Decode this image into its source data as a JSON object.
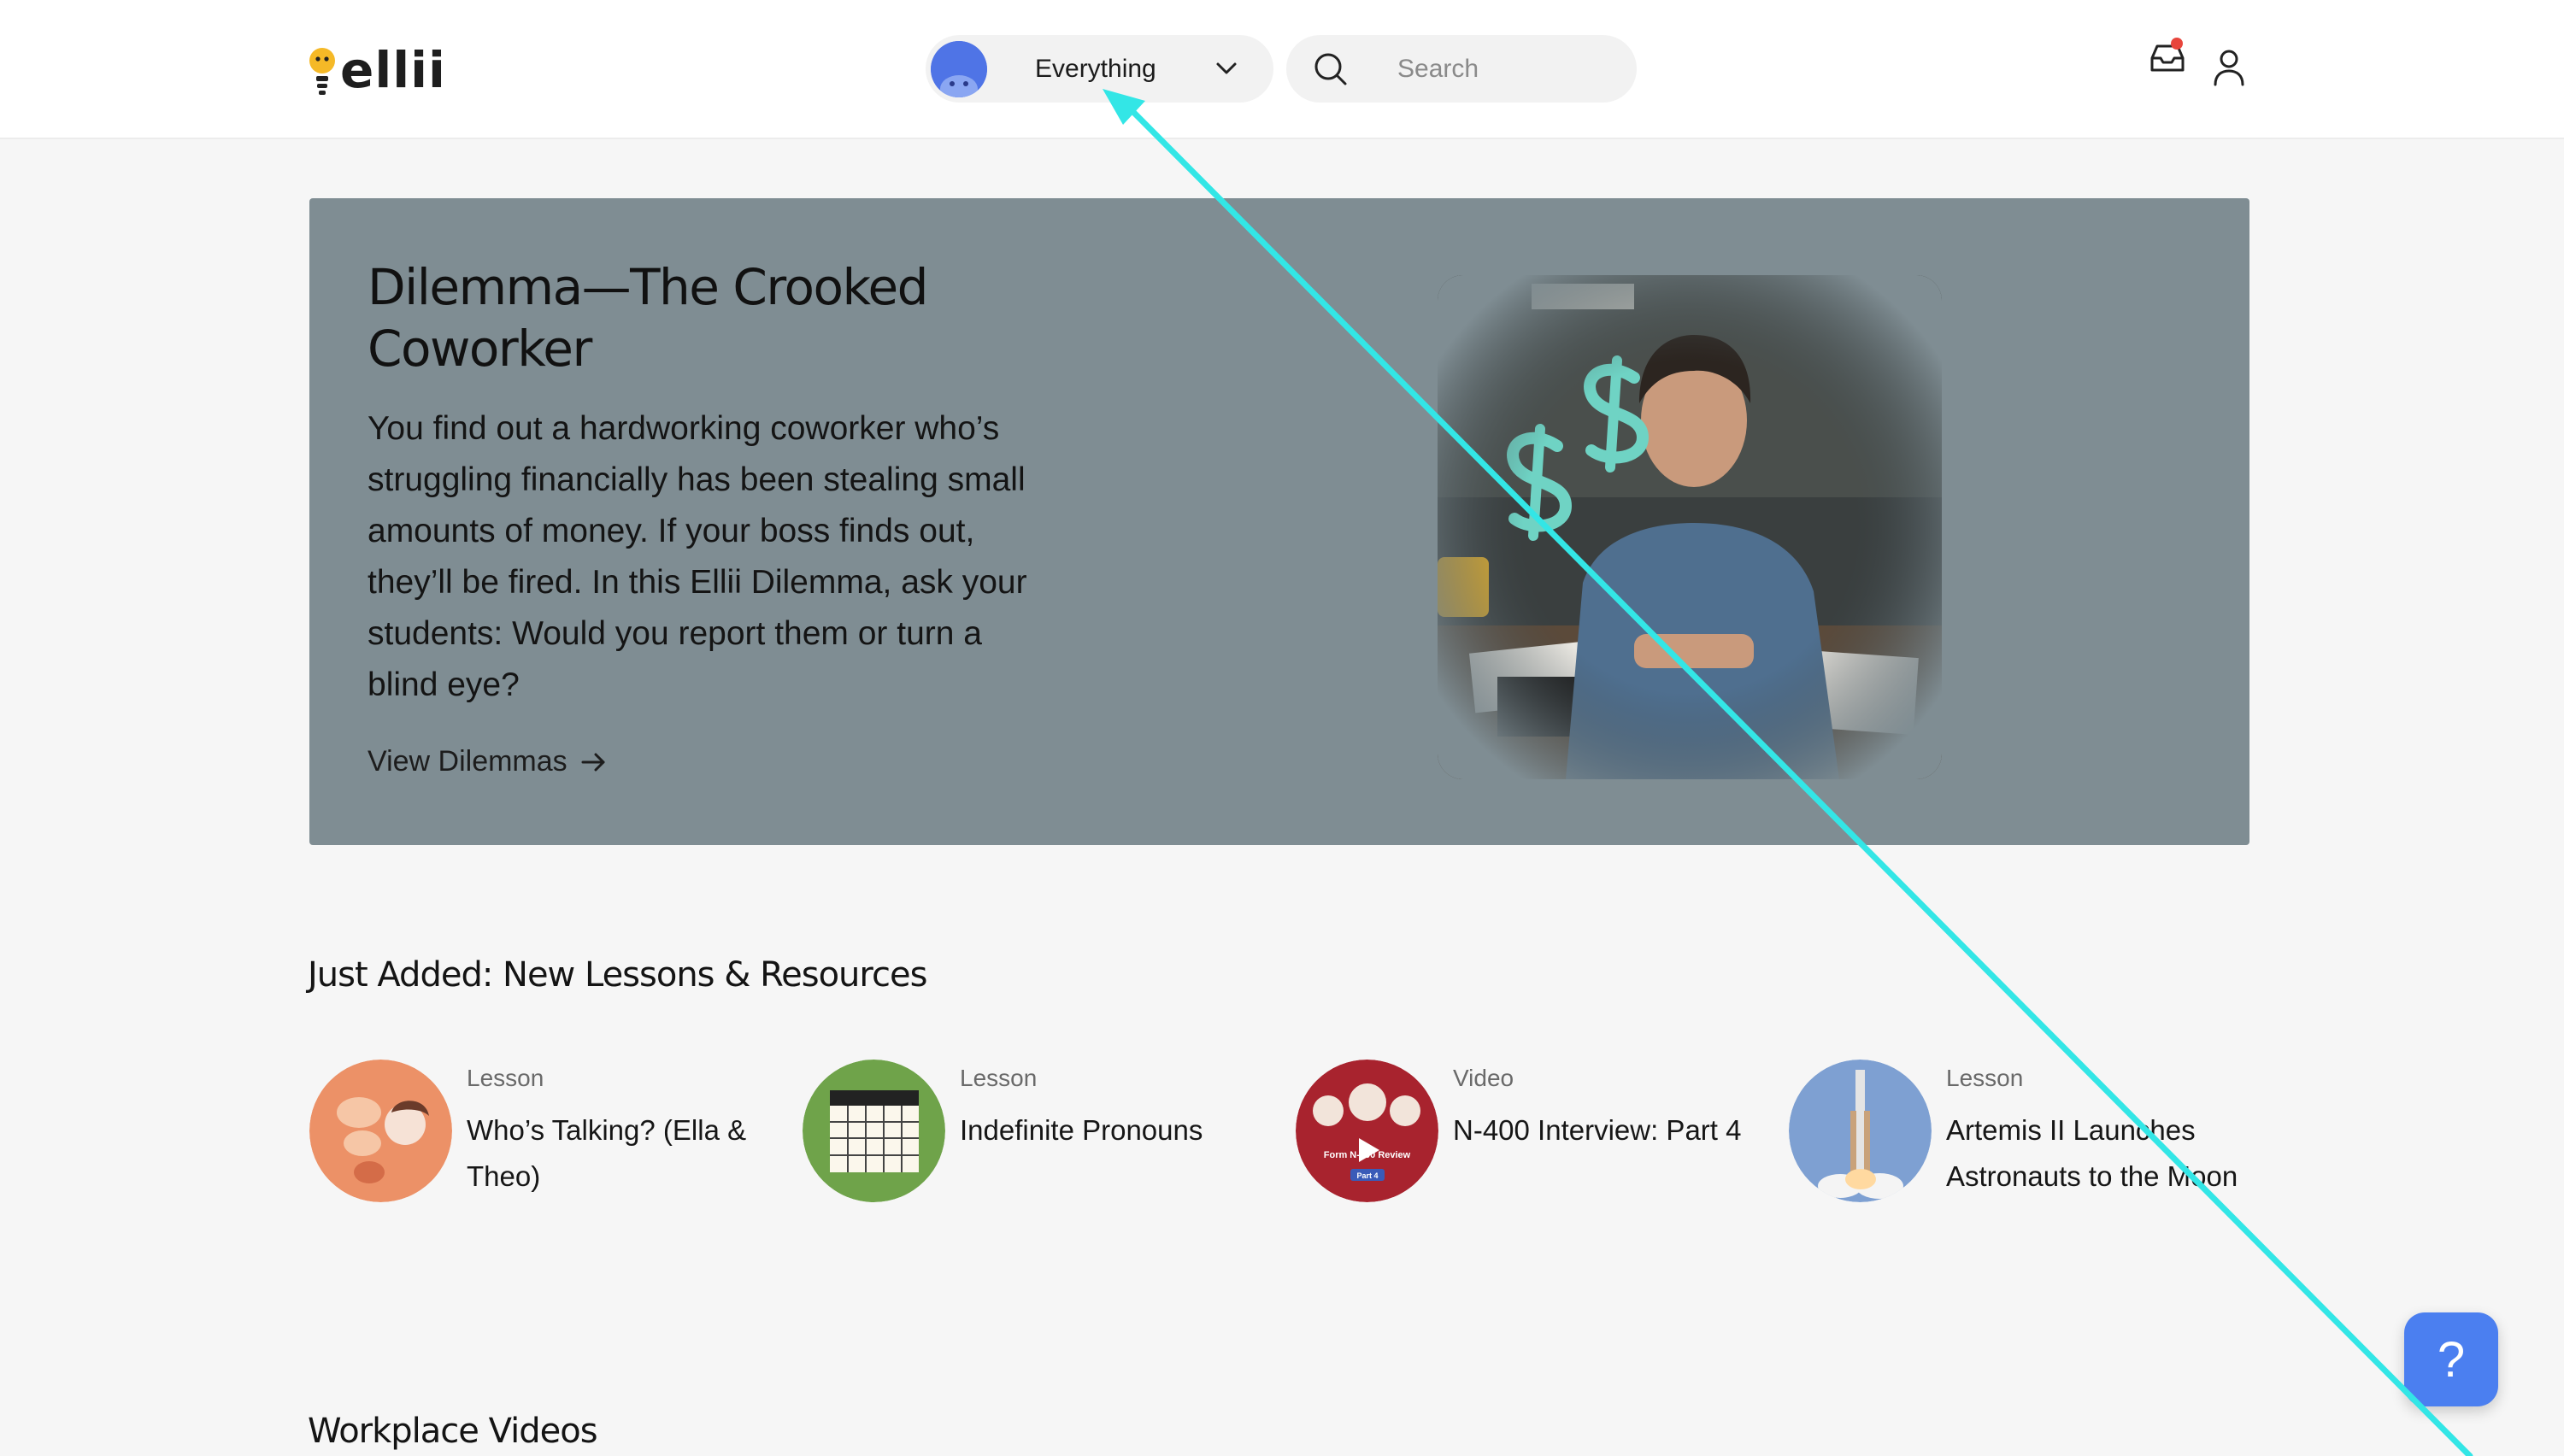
{
  "header": {
    "logo_text": "ellii",
    "scope_label": "Everything",
    "search_placeholder": "Search"
  },
  "hero": {
    "title": "Dilemma—The Crooked Coworker",
    "body": "You find out a hardworking coworker who’s struggling financially has been stealing small amounts of money. If your boss finds out, they’ll be fired. In this Ellii Dilemma, ask your students: Would you report them or turn a blind eye?",
    "link_label": "View Dilemmas",
    "background_color": "#7f8d93"
  },
  "just_added": {
    "heading": "Just Added: New Lessons & Resources",
    "items": [
      {
        "type": "Lesson",
        "title": "Who’s Talking? (Ella & Theo)",
        "thumb_color": "#ec9167"
      },
      {
        "type": "Lesson",
        "title": "Indefinite Pronouns",
        "thumb_color": "#6fa34a"
      },
      {
        "type": "Video",
        "title": "N-400 Interview: Part 4",
        "thumb_color": "#a8232e",
        "thumb_caption": "Form N-400 Review",
        "thumb_badge": "Part 4"
      },
      {
        "type": "Lesson",
        "title": "Artemis II Launches Astronauts to the Moon",
        "thumb_color": "#7ea0d2"
      }
    ]
  },
  "workplace": {
    "heading": "Workplace Videos"
  },
  "help_button": {
    "label": "?"
  },
  "annotation": {
    "arrow_color": "#33e6e6"
  }
}
